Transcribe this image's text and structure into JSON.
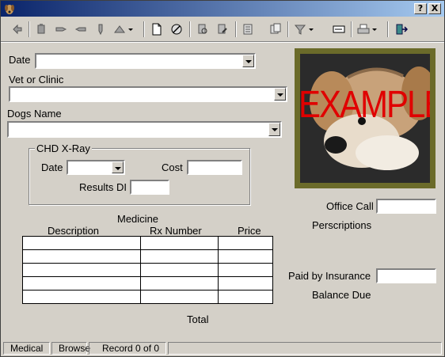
{
  "window": {
    "title": "",
    "help_label": "?",
    "close_label": "X"
  },
  "toolbar": {
    "icons": [
      "back-icon",
      "edit-icon",
      "point-right-icon",
      "point-left-icon",
      "point-down-icon",
      "jump-icon",
      "new-record-icon",
      "delete-icon",
      "find-icon",
      "replace-icon",
      "sort-icon",
      "view-icon",
      "filter-icon",
      "form-icon",
      "print-icon",
      "exit-icon"
    ]
  },
  "form": {
    "date_label": "Date",
    "vet_label": "Vet or Clinic",
    "dog_label": "Dogs Name",
    "chd_title": "CHD X-Ray",
    "chd_date_label": "Date",
    "chd_cost_label": "Cost",
    "chd_results_label": "Results DI",
    "medicine_title": "Medicine",
    "col_description": "Description",
    "col_rx": "Rx Number",
    "col_price": "Price",
    "total_label": "Total",
    "office_call_label": "Office Call",
    "prescriptions_label": "Perscriptions",
    "paid_insurance_label": "Paid by Insurance",
    "balance_due_label": "Balance Due",
    "photo_overlay": "EXAMPLE",
    "medicine_rows": 5
  },
  "status": {
    "layout": "Medical",
    "mode": "Browse",
    "record": "Record 0 of 0"
  },
  "colors": {
    "title_bar_start": "#0a246a",
    "window_bg": "#d4d0c8",
    "photo_frame": "#6b6b2a",
    "overlay_text": "#e00000"
  }
}
